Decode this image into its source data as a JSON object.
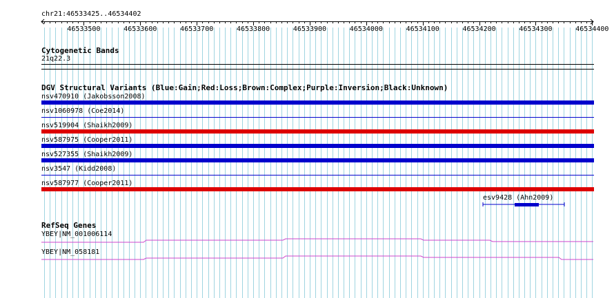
{
  "location_label": "chr21:46533425..46534402",
  "ruler": {
    "start": 46533425,
    "end": 46534402,
    "tick_labels": [
      "46533500",
      "46533600",
      "46533700",
      "46533800",
      "46533900",
      "46534000",
      "46534100",
      "46534200",
      "46534300",
      "46534400"
    ]
  },
  "tracks": {
    "cytoband": {
      "title": "Cytogenetic Bands",
      "band_label": "21q22.3"
    },
    "dgv": {
      "title": "DGV Structural Variants (Blue:Gain;Red:Loss;Brown:Complex;Purple:Inversion;Black:Unknown)",
      "variants": [
        {
          "label": "nsv470910 (Jakobsson2008)",
          "type": "gain"
        },
        {
          "label": "nsv1060978 (Coe2014)",
          "type": "unknown_thin"
        },
        {
          "label": "nsv519904 (Shaikh2009)",
          "type": "loss"
        },
        {
          "label": "nsv587975 (Cooper2011)",
          "type": "gain"
        },
        {
          "label": "nsv527355 (Shaikh2009)",
          "type": "gain"
        },
        {
          "label": "nsv3547 (Kidd2008)",
          "type": "unknown_thin"
        },
        {
          "label": "nsv587977 (Cooper2011)",
          "type": "loss"
        }
      ],
      "extra_feature": {
        "label": "esv9428 (Ahn2009)",
        "color": "#0000cc"
      }
    },
    "refseq": {
      "title": "RefSeq Genes",
      "genes": [
        {
          "label": "YBEY|NM_001006114"
        },
        {
          "label": "YBEY|NM_058181"
        }
      ]
    }
  },
  "colors": {
    "grid_line": "#9fd4e0",
    "gain": "#0000cc",
    "loss": "#dd0000",
    "gene": "#cc44cc"
  }
}
